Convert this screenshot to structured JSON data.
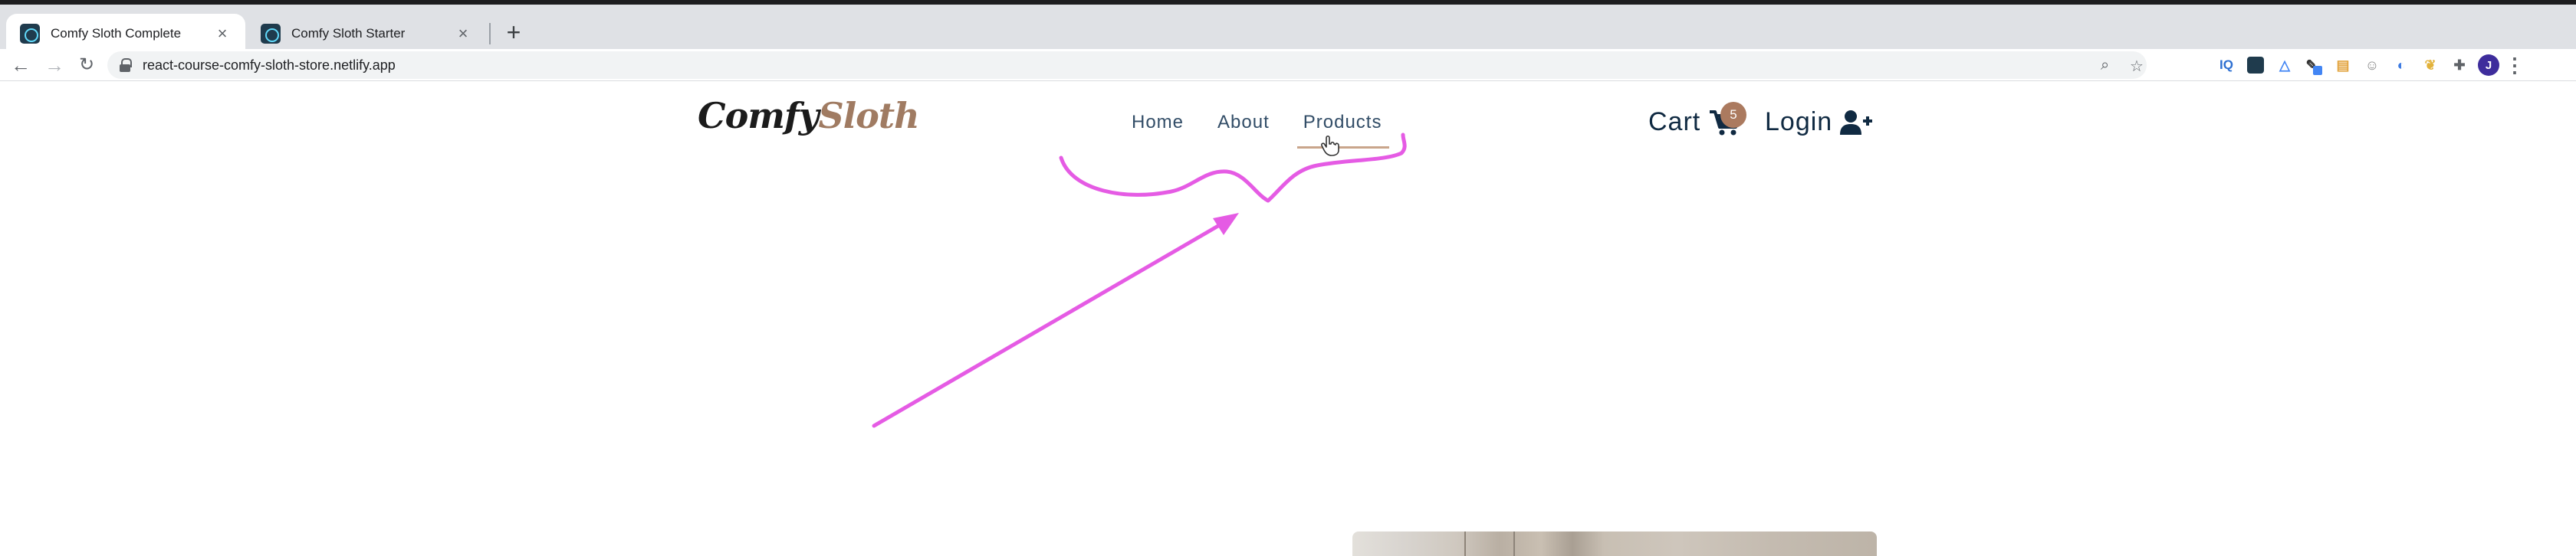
{
  "browser": {
    "tabs": [
      {
        "title": "Comfy Sloth Complete",
        "active": true
      },
      {
        "title": "Comfy Sloth Starter",
        "active": false
      }
    ],
    "url": "react-course-comfy-sloth-store.netlify.app",
    "extensions": [
      "IQ",
      "react-icon",
      "triangle-icon",
      "pen-icon",
      "box-icon",
      "face-icon",
      "o-icon",
      "leaf-icon",
      "puzzle-icon"
    ],
    "avatar_letter": "J"
  },
  "site": {
    "logo": {
      "part1": "Comfy",
      "part2": "Sloth"
    },
    "nav": {
      "home": "Home",
      "about": "About",
      "products": "Products"
    },
    "cart": {
      "label": "Cart",
      "count": "5"
    },
    "login": {
      "label": "Login"
    }
  },
  "colors": {
    "annotation": "#e55be4",
    "accent": "#ab7a5f",
    "nav_text": "#324d67",
    "heading_text": "#102a42"
  }
}
